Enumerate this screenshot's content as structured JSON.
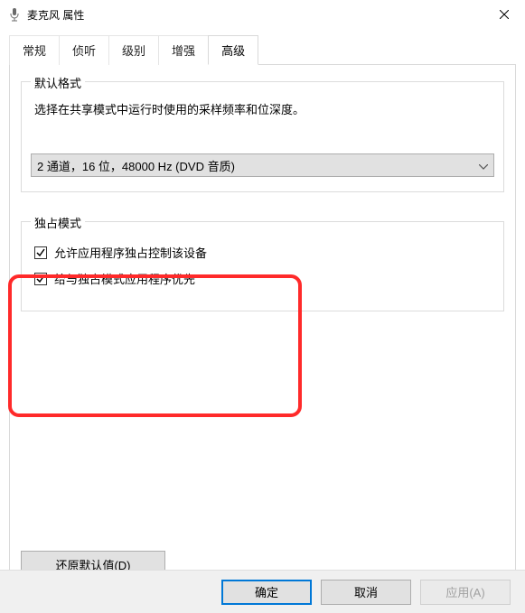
{
  "titlebar": {
    "title": "麦克风 属性"
  },
  "tabs": {
    "items": [
      {
        "label": "常规"
      },
      {
        "label": "侦听"
      },
      {
        "label": "级别"
      },
      {
        "label": "增强"
      },
      {
        "label": "高级"
      }
    ],
    "active_index": 4
  },
  "default_format": {
    "legend": "默认格式",
    "description": "选择在共享模式中运行时使用的采样频率和位深度。",
    "selected": "2 通道，16 位，48000 Hz (DVD 音质)"
  },
  "exclusive_mode": {
    "legend": "独占模式",
    "checkbox1": {
      "label": "允许应用程序独占控制该设备",
      "checked": true
    },
    "checkbox2": {
      "label": "给与独占模式应用程序优先",
      "checked": true
    }
  },
  "restore_defaults_label": "还原默认值(D)",
  "buttons": {
    "ok": "确定",
    "cancel": "取消",
    "apply": "应用(A)"
  }
}
